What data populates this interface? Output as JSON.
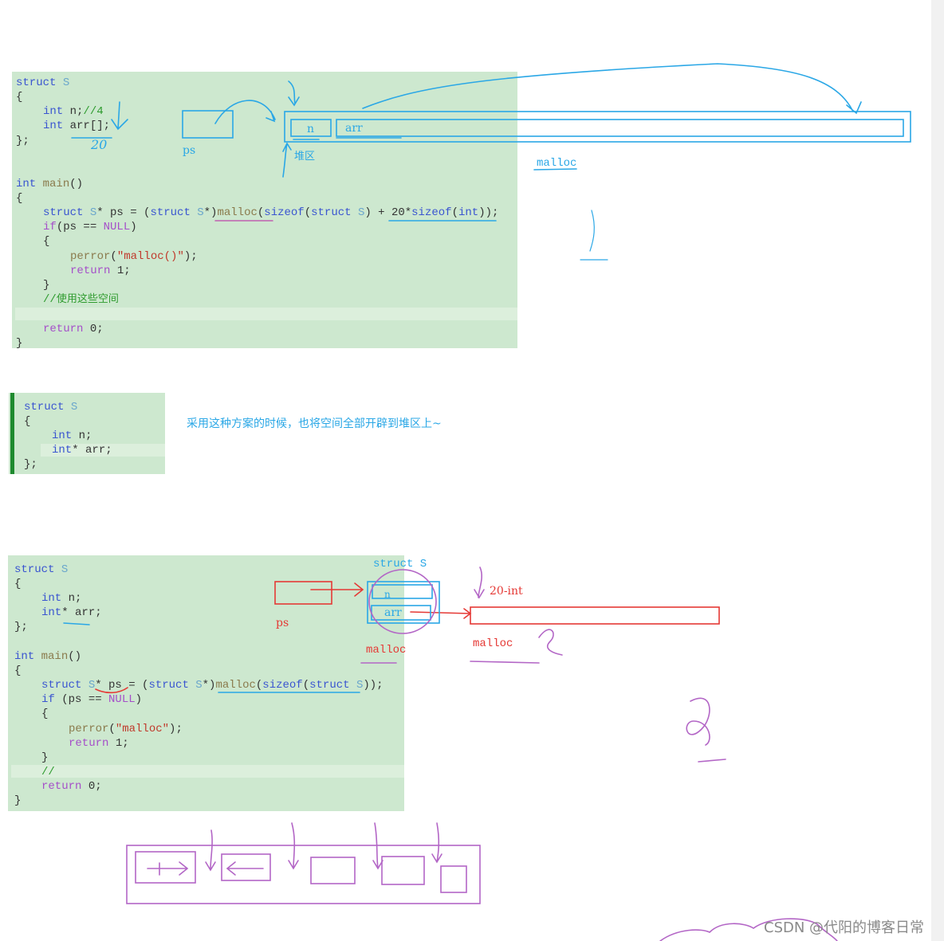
{
  "colors": {
    "panel": "#cde8cf",
    "blue_ink": "#2aa7e6",
    "red_ink": "#e53935",
    "purple_ink": "#b366c6",
    "keyword": "#3a55d0",
    "comment": "#2e9b2e",
    "string": "#c0392b"
  },
  "panel1": {
    "lines": [
      [
        [
          "struct ",
          "kw"
        ],
        [
          "S",
          "ty"
        ]
      ],
      [
        [
          "{",
          "pl"
        ]
      ],
      [
        [
          "int ",
          "kw"
        ],
        [
          "n;",
          "pl"
        ],
        [
          "//4",
          "cm"
        ]
      ],
      [
        [
          "int ",
          "kw"
        ],
        [
          "arr[];",
          "pl"
        ]
      ],
      [
        [
          "};",
          "pl"
        ]
      ],
      [],
      [],
      [
        [
          "int ",
          "kw"
        ],
        [
          "main",
          "fn"
        ],
        [
          "()",
          "pl"
        ]
      ],
      [
        [
          "{",
          "pl"
        ]
      ],
      [
        [
          "struct ",
          "kw"
        ],
        [
          "S",
          "ty"
        ],
        [
          "* ps = (",
          "pl"
        ],
        [
          "struct ",
          "kw"
        ],
        [
          "S",
          "ty"
        ],
        [
          "*)",
          "pl"
        ],
        [
          "malloc",
          "fn"
        ],
        [
          "(",
          "pl"
        ],
        [
          "sizeof",
          "kw"
        ],
        [
          "(",
          "pl"
        ],
        [
          "struct ",
          "kw"
        ],
        [
          "S",
          "ty"
        ],
        [
          ") + 20*",
          "pl"
        ],
        [
          "sizeof",
          "kw"
        ],
        [
          "(",
          "pl"
        ],
        [
          "int",
          "kw"
        ],
        [
          "));",
          "pl"
        ]
      ],
      [
        [
          "if",
          "pu"
        ],
        [
          "(ps == ",
          "pl"
        ],
        [
          "NULL",
          "pu"
        ],
        [
          ")",
          "pl"
        ]
      ],
      [
        [
          "{",
          "pl"
        ]
      ],
      [
        [
          "perror",
          "fn"
        ],
        [
          "(",
          "pl"
        ],
        [
          "\"malloc()\"",
          "str"
        ],
        [
          ");",
          "pl"
        ]
      ],
      [
        [
          "return ",
          "pu"
        ],
        [
          "1;",
          "pl"
        ]
      ],
      [
        [
          "}",
          "pl"
        ]
      ],
      [
        [
          "//",
          "cm"
        ],
        [
          "使用这些空间",
          "zh"
        ]
      ],
      [],
      [
        [
          "return ",
          "pu"
        ],
        [
          "0;",
          "pl"
        ]
      ],
      [
        [
          "}",
          "pl"
        ]
      ]
    ]
  },
  "panel2": {
    "lines": [
      [
        [
          "struct ",
          "kw"
        ],
        [
          "S",
          "ty"
        ]
      ],
      [
        [
          "{",
          "pl"
        ]
      ],
      [
        [
          "int ",
          "kw"
        ],
        [
          "n;",
          "pl"
        ]
      ],
      [
        [
          "int",
          "kw"
        ],
        [
          "* arr;",
          "pl"
        ]
      ],
      [
        [
          "};",
          "pl"
        ]
      ]
    ]
  },
  "panel3": {
    "lines": [
      [
        [
          "struct ",
          "kw"
        ],
        [
          "S",
          "ty"
        ]
      ],
      [
        [
          "{",
          "pl"
        ]
      ],
      [
        [
          "int ",
          "kw"
        ],
        [
          "n;",
          "pl"
        ]
      ],
      [
        [
          "int",
          "kw"
        ],
        [
          "* arr;",
          "pl"
        ]
      ],
      [
        [
          "};",
          "pl"
        ]
      ],
      [],
      [
        [
          "int ",
          "kw"
        ],
        [
          "main",
          "fn"
        ],
        [
          "()",
          "pl"
        ]
      ],
      [
        [
          "{",
          "pl"
        ]
      ],
      [
        [
          "struct ",
          "kw"
        ],
        [
          "S",
          "ty"
        ],
        [
          "* ps = (",
          "pl"
        ],
        [
          "struct ",
          "kw"
        ],
        [
          "S",
          "ty"
        ],
        [
          "*)",
          "pl"
        ],
        [
          "malloc",
          "fn"
        ],
        [
          "(",
          "pl"
        ],
        [
          "sizeof",
          "kw"
        ],
        [
          "(",
          "pl"
        ],
        [
          "struct ",
          "kw"
        ],
        [
          "S",
          "ty"
        ],
        [
          "));",
          "pl"
        ]
      ],
      [
        [
          "if ",
          "kw"
        ],
        [
          "(ps == ",
          "pl"
        ],
        [
          "NULL",
          "pu"
        ],
        [
          ")",
          "pl"
        ]
      ],
      [
        [
          "{",
          "pl"
        ]
      ],
      [
        [
          "perror",
          "fn"
        ],
        [
          "(",
          "pl"
        ],
        [
          "\"malloc\"",
          "str"
        ],
        [
          ");",
          "pl"
        ]
      ],
      [
        [
          "return ",
          "pu"
        ],
        [
          "1;",
          "pl"
        ]
      ],
      [
        [
          "}",
          "pl"
        ]
      ],
      [
        [
          "//",
          "cm"
        ]
      ],
      [
        [
          "return ",
          "pu"
        ],
        [
          "0;",
          "pl"
        ]
      ],
      [
        [
          "}",
          "pl"
        ]
      ]
    ]
  },
  "annotations": {
    "ps_label_1": "ps",
    "heap_label": "堆区",
    "n_box": "n",
    "arr_box": "arr",
    "malloc_label_1": "malloc",
    "twenty": "20",
    "note": "采用这种方案的时候，也将空间全部开辟到堆区上~",
    "struct_s_label": "struct S",
    "n_box_2": "n",
    "arr_box_2": "arr",
    "ps_label_2": "ps",
    "malloc_label_2": "malloc",
    "twenty_int": "20-int",
    "malloc_label_3": "malloc",
    "hand_1": "1",
    "hand_2a": "2",
    "hand_2b": "2"
  },
  "watermark": "CSDN @代阳的博客日常"
}
